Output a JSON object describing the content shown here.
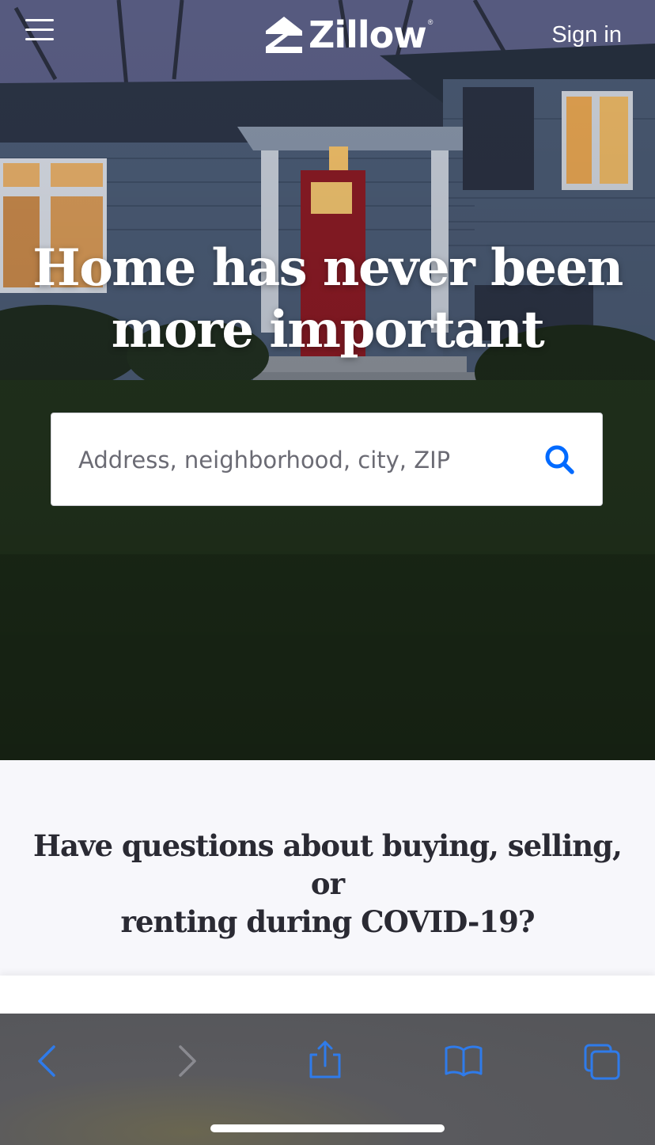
{
  "header": {
    "logo_text": "Zillow",
    "logo_registered": "®",
    "sign_in_label": "Sign in"
  },
  "hero": {
    "headline_line1": "Home has never been",
    "headline_line2": "more important"
  },
  "search": {
    "placeholder": "Address, neighborhood, city, ZIP"
  },
  "covid": {
    "title_line1": "Have questions about buying, selling, or",
    "title_line2": "renting during COVID-19?"
  },
  "toolbar": {
    "icons": [
      "back-icon",
      "forward-icon",
      "share-icon",
      "bookmarks-icon",
      "tabs-icon"
    ],
    "accent_color": "#2f7bea",
    "disabled_color": "#8a8a90"
  },
  "colors": {
    "brand_blue": "#006aff",
    "heading_dark": "#2a2a33"
  }
}
